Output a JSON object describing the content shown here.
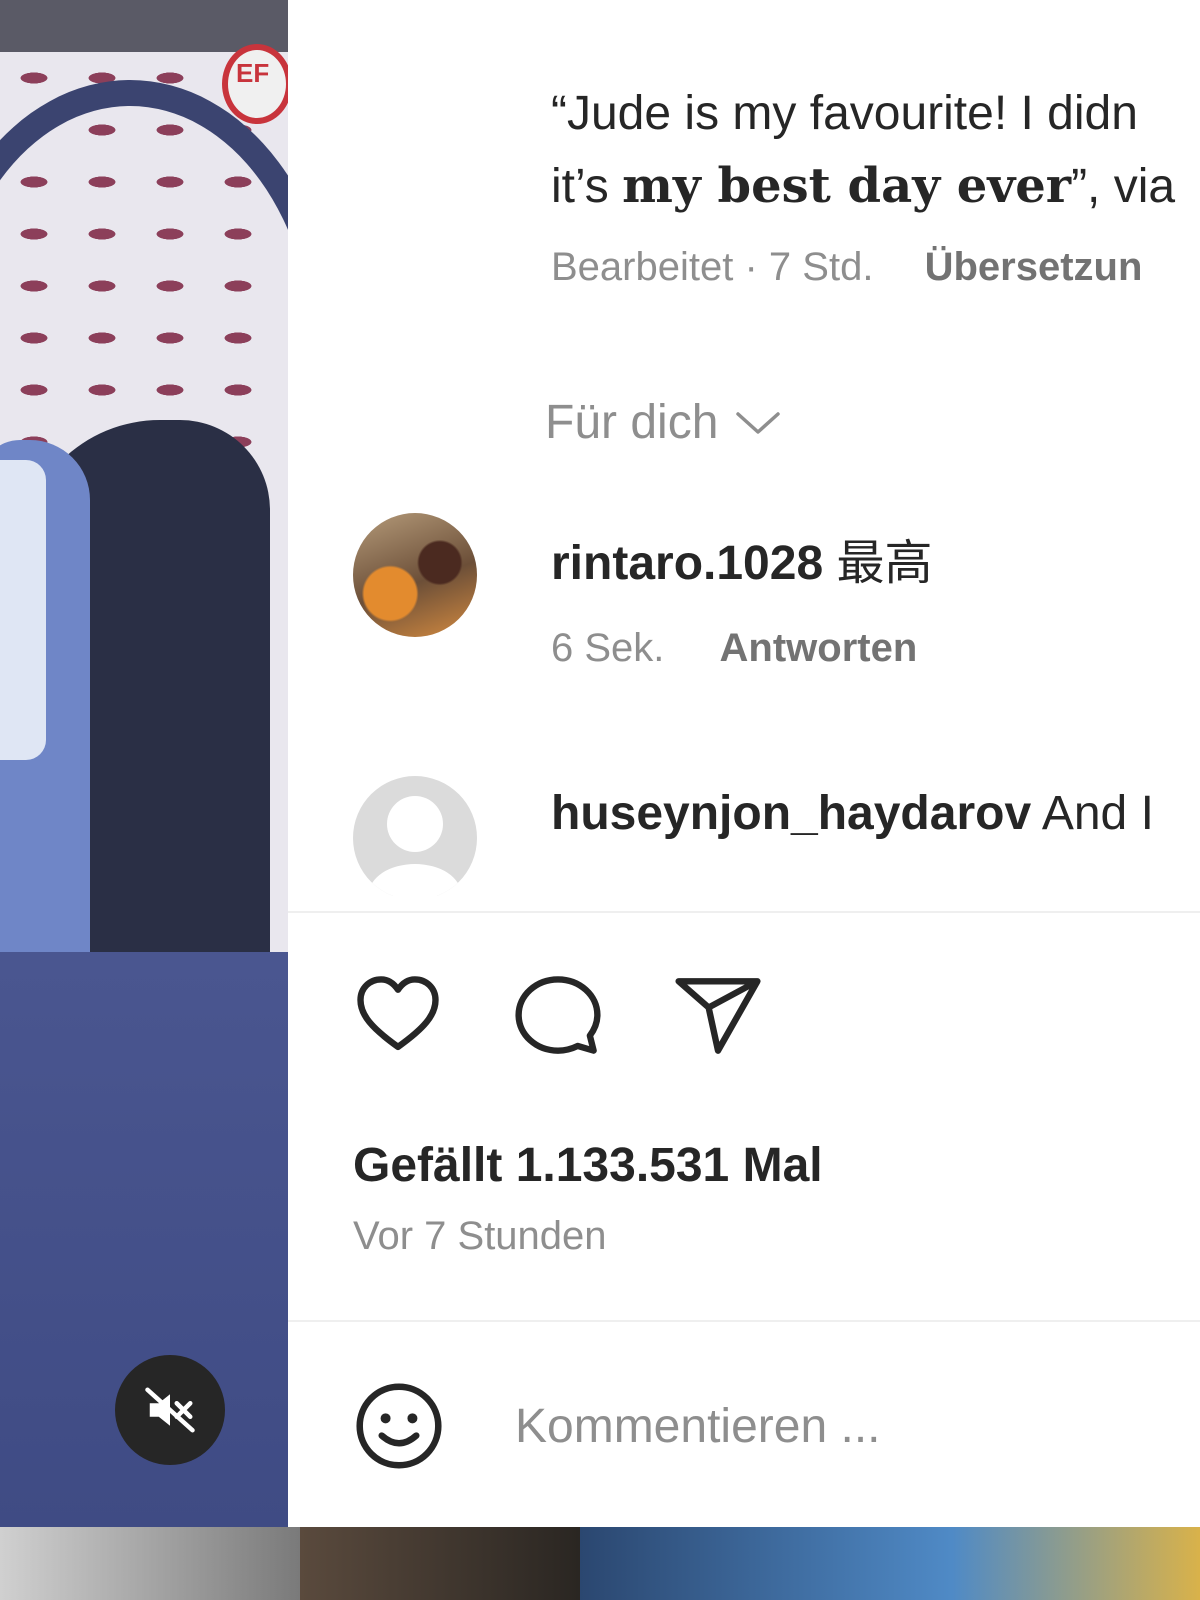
{
  "post": {
    "caption_line1": "“Jude is my favourite! I didn",
    "caption_line2_pre": "it’s ",
    "caption_line2_bold": "my best day ever",
    "caption_line2_post": "”, via",
    "edited_label": "Bearbeitet",
    "separator": "·",
    "age": "7 Std.",
    "translate_label": "Übersetzun"
  },
  "comments_sort": {
    "label": "Für dich",
    "icon": "chevron-down-icon"
  },
  "comments": [
    {
      "username": "rintaro.1028",
      "text": "最高",
      "age": "6 Sek.",
      "reply_label": "Antworten",
      "avatar": "photo"
    },
    {
      "username": "huseynjon_haydarov",
      "text": "And I",
      "avatar": "default-profile-icon"
    }
  ],
  "actions": {
    "like_icon": "heart-icon",
    "comment_icon": "comment-bubble-icon",
    "share_icon": "paper-plane-icon"
  },
  "likes_text": "Gefällt 1.133.531 Mal",
  "timestamp": "Vor 7 Stunden",
  "composer": {
    "emoji_icon": "smiley-icon",
    "placeholder": "Kommentieren ..."
  },
  "video": {
    "sign_text": "EF",
    "mute_icon": "speaker-muted-icon"
  }
}
